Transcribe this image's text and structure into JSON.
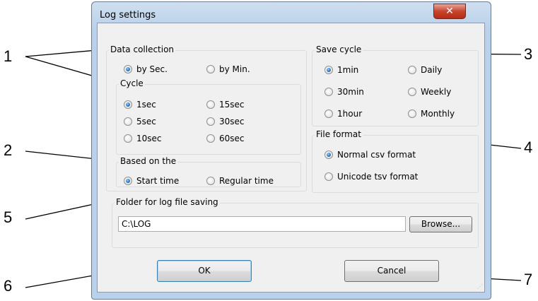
{
  "window": {
    "title": "Log settings",
    "close_glyph": "✕"
  },
  "data_collection": {
    "legend": "Data collection",
    "options": [
      {
        "label": "by Sec.",
        "checked": true
      },
      {
        "label": "by Min.",
        "checked": false
      }
    ]
  },
  "cycle": {
    "legend": "Cycle",
    "options": [
      {
        "label": "1sec",
        "checked": true
      },
      {
        "label": "15sec",
        "checked": false
      },
      {
        "label": "5sec",
        "checked": false
      },
      {
        "label": "30sec",
        "checked": false
      },
      {
        "label": "10sec",
        "checked": false
      },
      {
        "label": "60sec",
        "checked": false
      }
    ]
  },
  "based_on": {
    "legend": "Based on the",
    "options": [
      {
        "label": "Start time",
        "checked": true
      },
      {
        "label": "Regular time",
        "checked": false
      }
    ]
  },
  "save_cycle": {
    "legend": "Save cycle",
    "options": [
      {
        "label": "1min",
        "checked": true
      },
      {
        "label": "Daily",
        "checked": false
      },
      {
        "label": "30min",
        "checked": false
      },
      {
        "label": "Weekly",
        "checked": false
      },
      {
        "label": "1hour",
        "checked": false
      },
      {
        "label": "Monthly",
        "checked": false
      }
    ]
  },
  "file_format": {
    "legend": "File format",
    "options": [
      {
        "label": "Normal csv format",
        "checked": true
      },
      {
        "label": "Unicode tsv format",
        "checked": false
      }
    ]
  },
  "folder": {
    "legend": "Folder for log file saving",
    "path_value": "C:\\LOG",
    "browse_label": "Browse..."
  },
  "buttons": {
    "ok_label": "OK",
    "cancel_label": "Cancel"
  },
  "callouts": [
    "1",
    "2",
    "3",
    "4",
    "5",
    "6",
    "7"
  ]
}
